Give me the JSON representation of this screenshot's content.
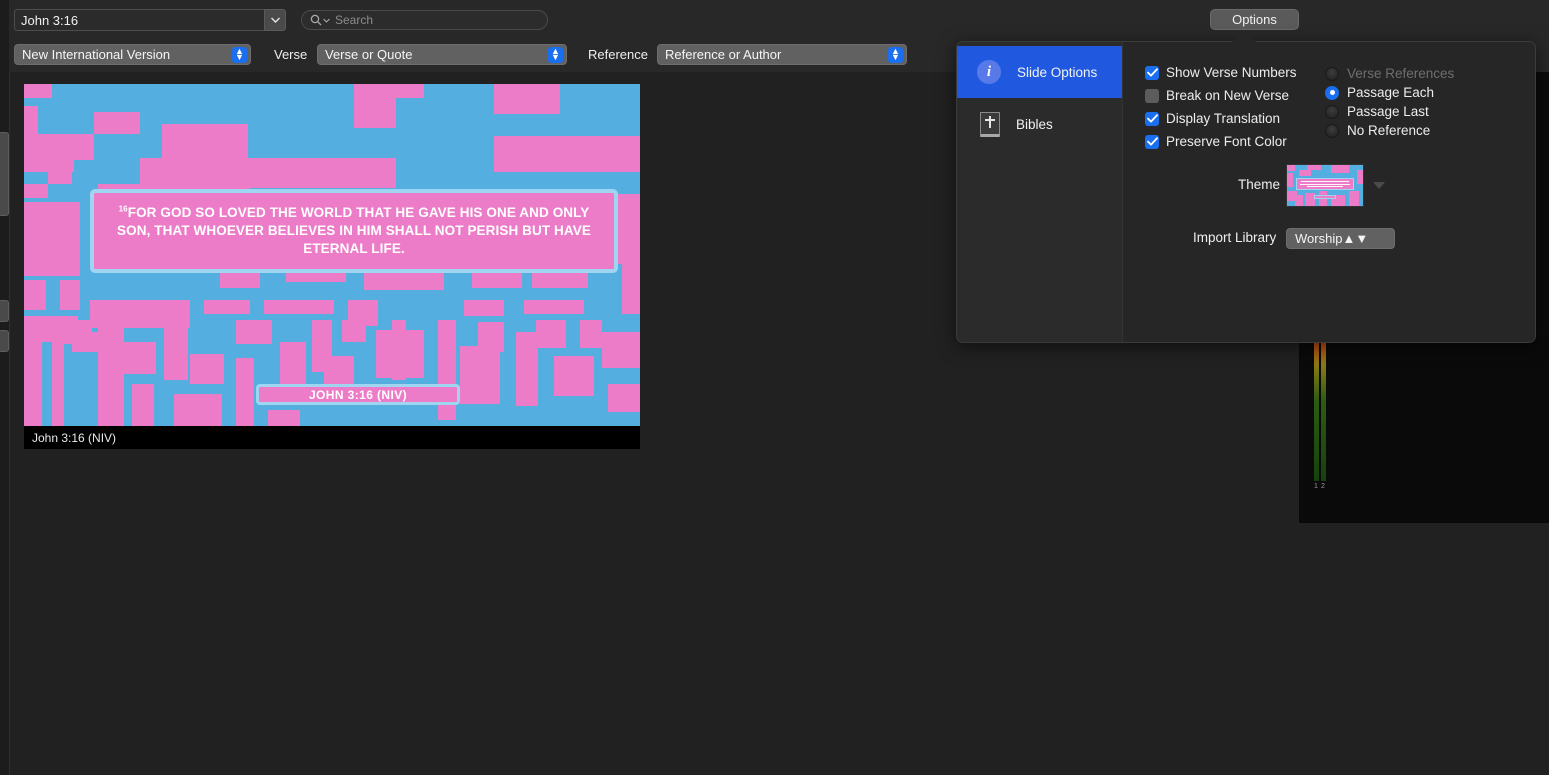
{
  "toolbar": {
    "reference_input_value": "John 3:16",
    "search_placeholder": "Search",
    "options_button_label": "Options",
    "translation_value": "New International Version",
    "verse_label": "Verse",
    "verse_value": "Verse or Quote",
    "reference_label": "Reference",
    "reference_value": "Reference or Author"
  },
  "slide": {
    "verse_number": "16",
    "verse_text": "FOR GOD SO LOVED THE WORLD THAT HE GAVE HIS ONE AND ONLY SON, THAT WHOEVER BELIEVES IN HIM SHALL NOT PERISH BUT HAVE ETERNAL LIFE.",
    "reference_text": "JOHN 3:16 (NIV)",
    "caption": "John 3:16 (NIV)",
    "colors": {
      "pink": "#ED7CC8",
      "blue": "#55AEE0",
      "border": "#9FD5F0",
      "text": "#FFFFFF"
    }
  },
  "popover": {
    "sidebar": [
      {
        "label": "Slide Options",
        "icon": "info-icon",
        "active": true
      },
      {
        "label": "Bibles",
        "icon": "bible-icon",
        "active": false
      }
    ],
    "checkboxes": [
      {
        "label": "Show Verse Numbers",
        "checked": true
      },
      {
        "label": "Break on New Verse",
        "checked": false
      },
      {
        "label": "Display Translation",
        "checked": true
      },
      {
        "label": "Preserve Font Color",
        "checked": true
      }
    ],
    "radios": [
      {
        "label": "Verse References",
        "selected": false,
        "disabled": true
      },
      {
        "label": "Passage Each",
        "selected": true,
        "disabled": false
      },
      {
        "label": "Passage Last",
        "selected": false,
        "disabled": false
      },
      {
        "label": "No Reference",
        "selected": false,
        "disabled": false
      }
    ],
    "theme_label": "Theme",
    "import_library_label": "Import Library",
    "import_library_value": "Worship"
  },
  "meters": {
    "channel_1": "1",
    "channel_2": "2"
  },
  "colors": {
    "accent": "#1A6EF0",
    "panel_bg": "#262626",
    "app_bg": "#212121",
    "toolbar_bg": "#282828"
  }
}
